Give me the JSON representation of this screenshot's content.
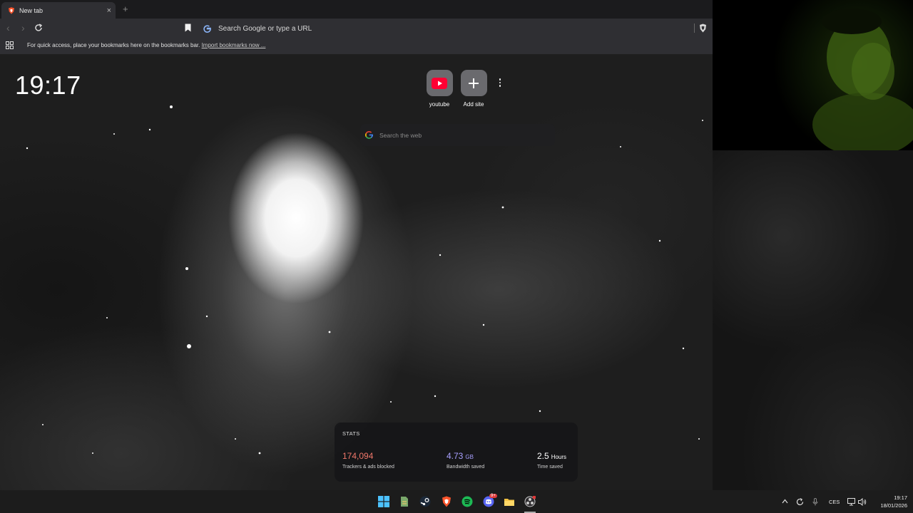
{
  "browser": {
    "tab": {
      "title": "New tab"
    },
    "new_tab_symbol": "+",
    "nav": {
      "back": "‹",
      "forward": "›"
    },
    "omnibox": {
      "placeholder": "Search Google or type a URL"
    },
    "bookmarks_bar": {
      "text": "For quick access, place your bookmarks here on the bookmarks bar.",
      "link": "Import bookmarks now ..."
    }
  },
  "ntp": {
    "clock": "19:17",
    "top_sites": [
      {
        "label": "youtube",
        "icon": "youtube-icon"
      },
      {
        "label": "Add site",
        "icon": "plus-icon"
      }
    ],
    "search": {
      "placeholder": "Search the web"
    },
    "stats": {
      "header": "STATS",
      "items": [
        {
          "value": "174,094",
          "unit": "",
          "caption": "Trackers & ads blocked",
          "color": "#f0776a"
        },
        {
          "value": "4.73",
          "unit": "GB",
          "caption": "Bandwidth saved",
          "color": "#a9a0ff"
        },
        {
          "value": "2.5",
          "unit": "Hours",
          "caption": "Time saved",
          "color": "#ffffff"
        }
      ]
    }
  },
  "taskbar": {
    "pinned": [
      "windows-start-icon",
      "file-icon",
      "steam-icon",
      "brave-icon",
      "spotify-icon",
      "discord-icon",
      "file-explorer-icon",
      "obs-icon"
    ],
    "discord_badge": "9+",
    "language": "CES",
    "time": "19:17",
    "date": "18/01/2026"
  },
  "colors": {
    "brave_orange": "#fb542b",
    "youtube_red": "#ff0033",
    "spotify_green": "#1db954",
    "discord_blurple": "#5865f2"
  }
}
